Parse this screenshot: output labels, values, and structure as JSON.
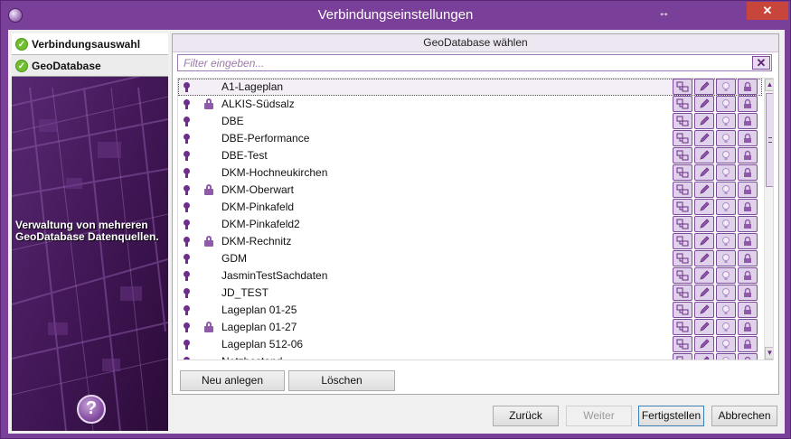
{
  "window": {
    "title": "Verbindungseinstellungen",
    "resize_glyph": "↔",
    "close_glyph": "✕"
  },
  "steps": [
    {
      "label": "Verbindungsauswahl",
      "status": "done"
    },
    {
      "label": "GeoDatabase",
      "status": "done"
    }
  ],
  "left": {
    "description": "Verwaltung von mehreren GeoDatabase Datenquellen.",
    "help_glyph": "?"
  },
  "panel": {
    "title": "GeoDatabase wählen",
    "filter_placeholder": "Filter eingeben...",
    "filter_clear_glyph": "✕"
  },
  "rows": [
    {
      "name": "A1-Lageplan",
      "locked": false,
      "selected": true
    },
    {
      "name": "ALKIS-Südsalz",
      "locked": true,
      "selected": false
    },
    {
      "name": "DBE",
      "locked": false,
      "selected": false
    },
    {
      "name": "DBE-Performance",
      "locked": false,
      "selected": false
    },
    {
      "name": "DBE-Test",
      "locked": false,
      "selected": false
    },
    {
      "name": "DKM-Hochneukirchen",
      "locked": false,
      "selected": false
    },
    {
      "name": "DKM-Oberwart",
      "locked": true,
      "selected": false
    },
    {
      "name": "DKM-Pinkafeld",
      "locked": false,
      "selected": false
    },
    {
      "name": "DKM-Pinkafeld2",
      "locked": false,
      "selected": false
    },
    {
      "name": "DKM-Rechnitz",
      "locked": true,
      "selected": false
    },
    {
      "name": "GDM",
      "locked": false,
      "selected": false
    },
    {
      "name": "JasminTestSachdaten",
      "locked": false,
      "selected": false
    },
    {
      "name": "JD_TEST",
      "locked": false,
      "selected": false
    },
    {
      "name": "Lageplan 01-25",
      "locked": false,
      "selected": false
    },
    {
      "name": "Lageplan 01-27",
      "locked": true,
      "selected": false
    },
    {
      "name": "Lageplan 512-06",
      "locked": false,
      "selected": false
    },
    {
      "name": "Netzbestand",
      "locked": false,
      "selected": false
    }
  ],
  "row_action_icons": [
    "connect-icon",
    "edit-icon",
    "bulb-icon",
    "lock-icon"
  ],
  "scrollbar": {
    "up_glyph": "▲",
    "down_glyph": "▼"
  },
  "panel_buttons": {
    "new": "Neu anlegen",
    "delete": "Löschen"
  },
  "footer_buttons": {
    "back": "Zurück",
    "next": "Weiter",
    "finish": "Fertigstellen",
    "cancel": "Abbrechen"
  },
  "colors": {
    "frame": "#7a3f98",
    "accent": "#6a2d86",
    "close": "#c7453a",
    "check": "#6fbf2e"
  }
}
